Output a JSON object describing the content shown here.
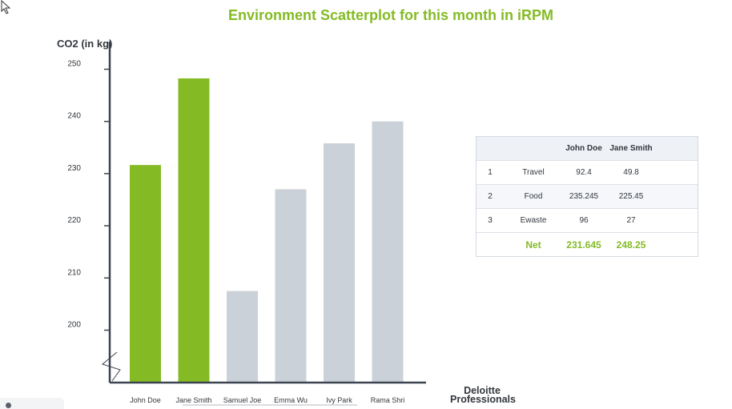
{
  "title": "Environment Scatterplot for this month in iRPM",
  "chart_data": {
    "type": "bar",
    "title": "Environment Scatterplot for this month in iRPM",
    "ylabel": "CO2 (in kg)",
    "xlabel": "Deloitte Professionals",
    "xlabel_lines": [
      "Deloitte",
      "Professionals"
    ],
    "categories": [
      "John Doe",
      "Jane Smith",
      "Samuel Joe",
      "Emma Wu",
      "Ivy Park",
      "Rama Shri"
    ],
    "values": [
      231.645,
      248.25,
      207.5,
      227.0,
      235.8,
      240.0
    ],
    "highlighted": [
      true,
      true,
      false,
      false,
      false,
      false
    ],
    "yticks": [
      200,
      210,
      220,
      230,
      240,
      250
    ],
    "ylim": [
      192,
      252
    ],
    "axis_break": true,
    "grid": false,
    "colors": {
      "highlight": "#84bb25",
      "default": "#cbd1d8",
      "axis": "#3d4451"
    }
  },
  "table": {
    "headers": [
      "",
      "",
      "John Doe",
      "Jane Smith"
    ],
    "rows": [
      [
        "1",
        "Travel",
        "92.4",
        "49.8"
      ],
      [
        "2",
        "Food",
        "235.245",
        "225.45"
      ],
      [
        "3",
        "Ewaste",
        "96",
        "27"
      ]
    ],
    "net": {
      "label": "Net",
      "values": [
        "231.645",
        "248.25"
      ]
    }
  }
}
